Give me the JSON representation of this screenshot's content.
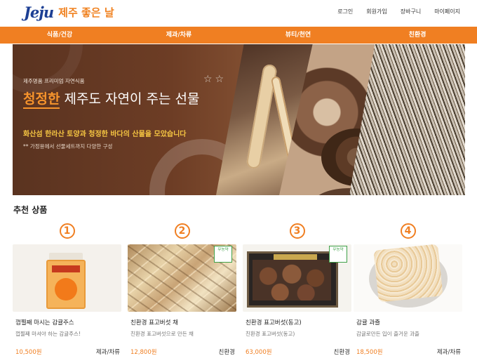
{
  "brand": {
    "logo": "Jeju",
    "name": "제주 좋은 날"
  },
  "topnav": [
    "로그인",
    "회원가입",
    "장바구니",
    "마이페이지"
  ],
  "gnb": [
    "식품/건강",
    "제과/차류",
    "뷰티/천연",
    "친환경"
  ],
  "banner": {
    "sub": "제주명품 프리미엄 자연식품",
    "title_highlight": "청정한",
    "title_rest": "제주도 자연이 주는 선물",
    "stars": "☆☆",
    "desc": "화산섬 한라산 토양과 청정한 바다의 산물을 모았습니다",
    "note": "** 가정용에서 선물세트까지 다양한 구성"
  },
  "section_title": "추천 상품",
  "products": [
    {
      "num": "1",
      "name": "껍찔째 마시는 감귤주스",
      "desc": "껍찔째 마셔야 하는 감귤주스!",
      "price": "10,500원",
      "category": "제과/차류"
    },
    {
      "num": "2",
      "name": "친환경 표고버섯 채",
      "desc": "친환경 표고버섯으로 만든 채",
      "price": "12,800원",
      "category": "친환경",
      "badge": "무농약"
    },
    {
      "num": "3",
      "name": "친환경 표고버섯(동고)",
      "desc": "친환경 표고버섯(동고)",
      "price": "63,000원",
      "category": "친환경",
      "badge": "무농약"
    },
    {
      "num": "4",
      "name": "감귤 과즐",
      "desc": "감귤로만든 입이 즐거운 과즐",
      "price": "18,500원",
      "category": "제과/차류"
    }
  ],
  "colors": {
    "accent": "#f07f22",
    "banner_bg": "#5a3320",
    "highlight": "#f5c542",
    "badge": "#3fa148"
  }
}
